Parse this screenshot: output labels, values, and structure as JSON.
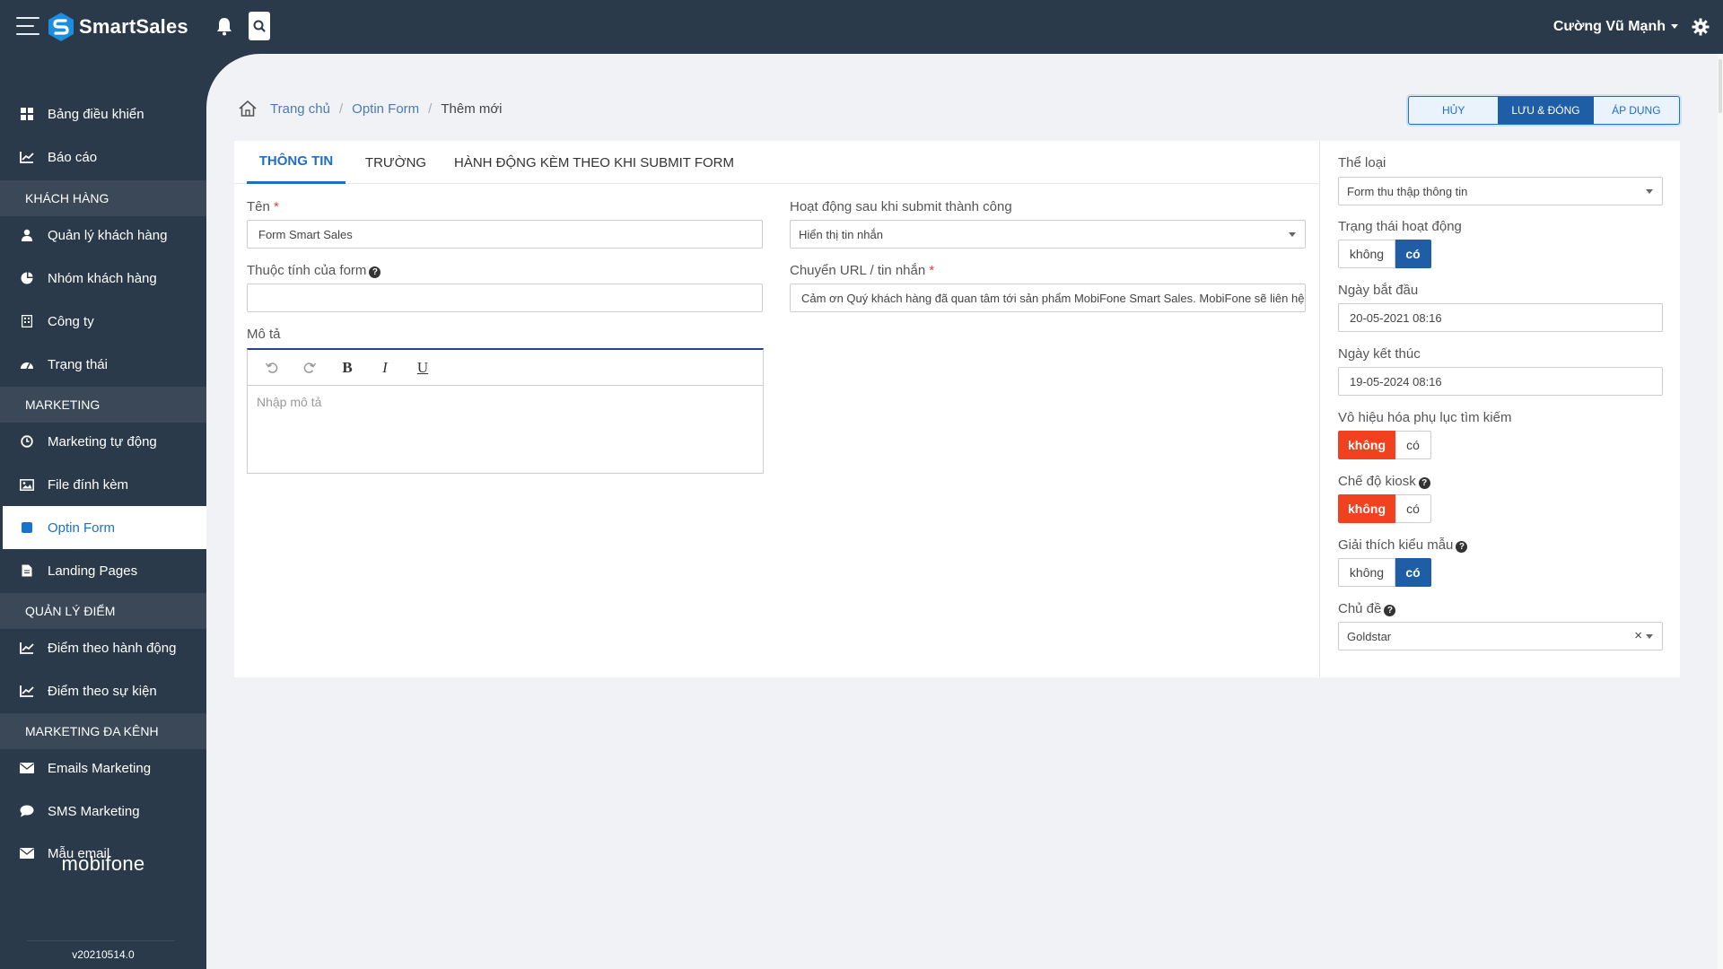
{
  "header": {
    "brand": "SmartSales",
    "user_name": "Cường Vũ Mạnh"
  },
  "sidebar": {
    "items": [
      {
        "label": "Bảng điều khiển",
        "icon": "dashboard-icon"
      },
      {
        "label": "Báo cáo",
        "icon": "line-chart-icon"
      },
      {
        "section": "KHÁCH HÀNG"
      },
      {
        "label": "Quản lý khách hàng",
        "icon": "user-icon"
      },
      {
        "label": "Nhóm khách hàng",
        "icon": "pie-chart-icon"
      },
      {
        "label": "Công ty",
        "icon": "building-icon"
      },
      {
        "label": "Trạng thái",
        "icon": "gauge-icon"
      },
      {
        "section": "MARKETING"
      },
      {
        "label": "Marketing tự động",
        "icon": "clock-icon"
      },
      {
        "label": "File đính kèm",
        "icon": "image-icon"
      },
      {
        "label": "Optin Form",
        "icon": "square-icon",
        "active": true
      },
      {
        "label": "Landing Pages",
        "icon": "file-icon"
      },
      {
        "section": "QUẢN LÝ ĐIỂM"
      },
      {
        "label": "Điểm theo hành động",
        "icon": "line-chart-icon"
      },
      {
        "label": "Điểm theo sự kiện",
        "icon": "line-chart-icon"
      },
      {
        "section": "MARKETING ĐA KÊNH"
      },
      {
        "label": "Emails Marketing",
        "icon": "envelope-icon"
      },
      {
        "label": "SMS Marketing",
        "icon": "comment-icon"
      },
      {
        "label": "Mẫu email",
        "icon": "envelope-icon"
      }
    ],
    "footer_brand": "mobifone",
    "version": "v20210514.0"
  },
  "breadcrumb": {
    "home": "Trang chủ",
    "parent": "Optin Form",
    "current": "Thêm mới"
  },
  "actions": {
    "cancel": "HỦY",
    "save_close": "LƯU & ĐÓNG",
    "apply": "ÁP DỤNG"
  },
  "tabs": [
    {
      "label": "THÔNG TIN",
      "active": true
    },
    {
      "label": "TRƯỜNG"
    },
    {
      "label": "HÀNH ĐỘNG KÈM THEO KHI SUBMIT FORM"
    }
  ],
  "form": {
    "name_label": "Tên",
    "name_value": "Form Smart Sales",
    "attr_label": "Thuộc tính của form",
    "attr_value": "",
    "desc_label": "Mô tả",
    "desc_placeholder": "Nhập mô tả",
    "after_submit_label": "Hoạt động sau khi submit thành công",
    "after_submit_value": "Hiển thị tin nhắn",
    "redirect_label": "Chuyển URL / tin nhắn",
    "redirect_value": "Cảm ơn Quý khách hàng đã quan tâm tới sản phẩm MobiFone Smart Sales. MobiFone sẽ liên hệ với Quý khách hàng trong thời gian sớm nhất"
  },
  "side": {
    "category_label": "Thể loại",
    "category_value": "Form thu thập thông tin",
    "status_label": "Trạng thái hoạt động",
    "start_label": "Ngày bắt đầu",
    "start_value": "20-05-2021 08:16",
    "end_label": "Ngày kết thúc",
    "end_value": "19-05-2024 08:16",
    "disable_search_label": "Vô hiệu hóa phụ lục tìm kiếm",
    "kiosk_label": "Chế độ kiosk",
    "explain_label": "Giải thích kiểu mẫu",
    "theme_label": "Chủ đề",
    "theme_value": "Goldstar",
    "no": "không",
    "yes": "có",
    "clear": "×"
  },
  "colors": {
    "sidebar_bg": "#2b3a4a",
    "accent_blue": "#1f5da6",
    "toggle_red": "#f2411f"
  }
}
